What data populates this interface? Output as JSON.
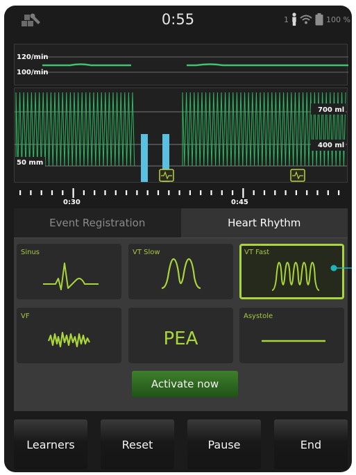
{
  "status": {
    "time": "0:55",
    "person_count": "1",
    "battery": "100 %",
    "icons": [
      "tools-icon",
      "person-icon",
      "wifi-icon",
      "battery-icon"
    ]
  },
  "trend": {
    "upper_label": "120/min",
    "lower_label": "100/min",
    "line_color": "#3ec46d"
  },
  "wave": {
    "label_top_right": "700 ml",
    "label_mid_right": "400 ml",
    "label_left": "50 mm",
    "wave_color": "#2fb860",
    "bar_color": "#5bbfe0"
  },
  "timeline": {
    "labels": [
      "0:30",
      "0:45"
    ]
  },
  "tabs": {
    "event_registration": "Event Registration",
    "heart_rhythm": "Heart Rhythm",
    "active": "Heart Rhythm"
  },
  "rhythms": {
    "sinus": "Sinus",
    "vt_slow": "VT Slow",
    "vt_fast": "VT Fast",
    "vf": "VF",
    "pea": "PEA",
    "asystole": "Asystole",
    "selected": "VT Fast"
  },
  "activate_label": "Activate now",
  "buttons": {
    "learners": "Learners",
    "reset": "Reset",
    "pause": "Pause",
    "end": "End"
  },
  "accent_color": "#a9d63a"
}
